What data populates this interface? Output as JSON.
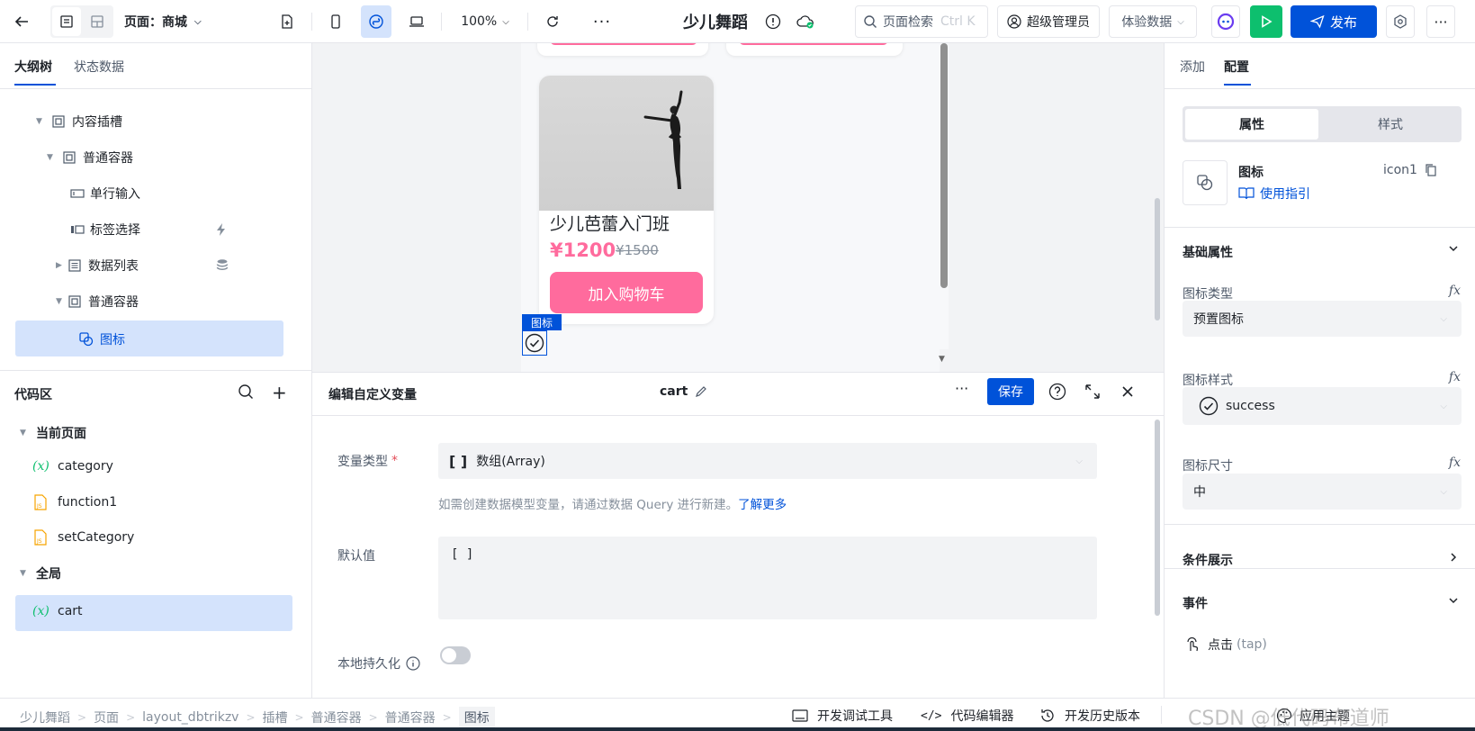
{
  "topbar": {
    "page_label": "页面：商城",
    "zoom": "100%",
    "app_title": "少儿舞蹈",
    "search_placeholder": "页面检索",
    "search_shortcut": "Ctrl K",
    "user_role": "超级管理员",
    "data_env": "体验数据",
    "publish_label": "发布"
  },
  "left_tabs": {
    "outline": "大纲树",
    "state": "状态数据"
  },
  "tree": [
    {
      "label": "内容插槽"
    },
    {
      "label": "普通容器"
    },
    {
      "label": "单行输入"
    },
    {
      "label": "标签选择"
    },
    {
      "label": "数据列表"
    },
    {
      "label": "普通容器"
    },
    {
      "label": "图标"
    }
  ],
  "code_area": {
    "title": "代码区",
    "current_page": "当前页面",
    "items": [
      "category",
      "function1",
      "setCategory"
    ],
    "global": "全局",
    "global_items": [
      "cart"
    ]
  },
  "canvas": {
    "product_name": "少儿芭蕾入门班",
    "price": "¥1200",
    "original_price": "¥1500",
    "add_cart": "加入购物车",
    "selected_tag": "图标"
  },
  "editor": {
    "title": "编辑自定义变量",
    "var_name": "cart",
    "save_label": "保存",
    "type_label": "变量类型",
    "required_mark": "*",
    "type_value": "数组(Array)",
    "hint": "如需创建数据模型变量，请通过数据 Query 进行新建。",
    "hint_link": "了解更多",
    "default_label": "默认值",
    "default_value": "[ ]",
    "persist_label": "本地持久化",
    "persist_on": false
  },
  "right": {
    "tabs": {
      "add": "添加",
      "config": "配置"
    },
    "seg": {
      "props": "属性",
      "style": "样式"
    },
    "component_name": "图标",
    "component_id": "icon1",
    "guide": "使用指引",
    "basic_props": "基础属性",
    "icon_type_label": "图标类型",
    "icon_type_value": "预置图标",
    "icon_style_label": "图标样式",
    "icon_style_value": "success",
    "icon_size_label": "图标尺寸",
    "icon_size_value": "中",
    "condition": "条件展示",
    "events": "事件",
    "event_item": "点击",
    "event_sub": "(tap)",
    "fx": "fx"
  },
  "statusbar": {
    "breadcrumbs": [
      "少儿舞蹈",
      "页面",
      "layout_dbtrikzv",
      "插槽",
      "普通容器",
      "普通容器",
      "图标"
    ],
    "debug": "开发调试工具",
    "code_editor": "代码编辑器",
    "history": "开发历史版本",
    "theme": "应用主题"
  },
  "watermark": "CSDN @低代码布道师",
  "colors": {
    "primary": "#0052d9",
    "pink": "#ff6b9d",
    "green": "#0dbf6e",
    "selected_bg": "#d4e3fc"
  }
}
